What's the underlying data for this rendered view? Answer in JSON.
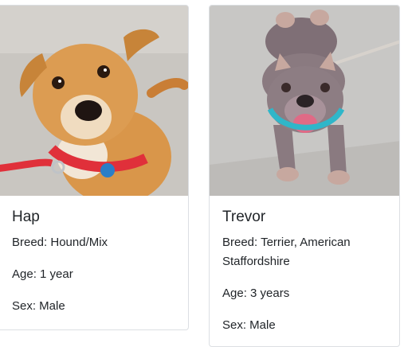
{
  "cards": [
    {
      "name": "Hap",
      "breed": "Breed: Hound/Mix",
      "age": "Age: 1 year",
      "sex": "Sex: Male",
      "photo_icon": "dog-photo-hap"
    },
    {
      "name": "Trevor",
      "breed": "Breed: Terrier, American Staffordshire",
      "age": "Age: 3 years",
      "sex": "Sex: Male",
      "photo_icon": "dog-photo-trevor"
    }
  ],
  "colors": {
    "card_border": "#dcdfe3",
    "text": "#212529",
    "hap_fur": "#d9964a",
    "hap_collar": "#e0303a",
    "trevor_fur": "#8a7a80",
    "trevor_collar": "#2fb6c9"
  }
}
